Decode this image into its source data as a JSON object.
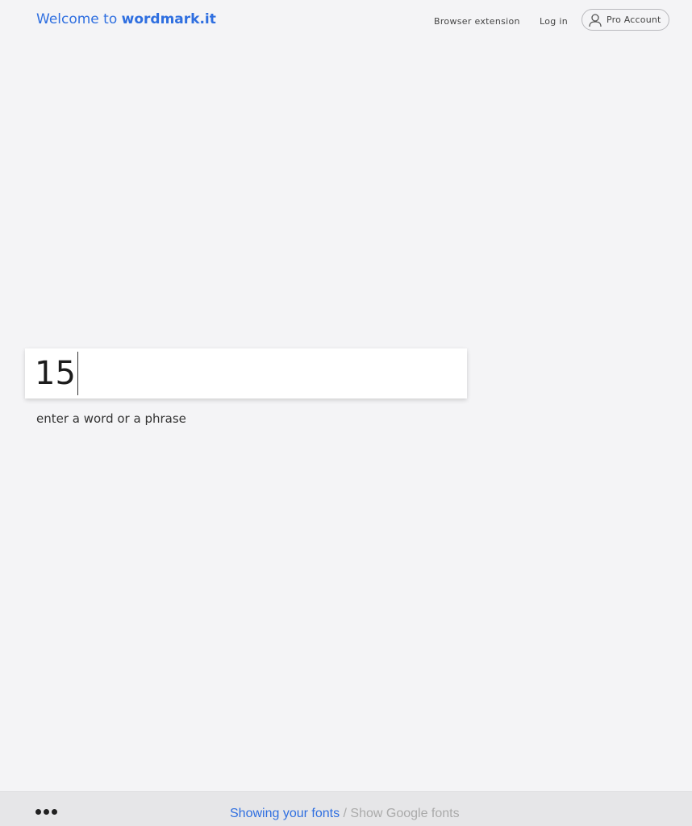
{
  "header": {
    "brand_prefix": "Welcome to ",
    "brand_name": "wordmark.it",
    "nav": {
      "browser_extension": "Browser extension",
      "log_in": "Log in",
      "pro_account": "Pro Account"
    },
    "pro_icon": "user-icon"
  },
  "main": {
    "input_value": "15",
    "hint": "enter a word or a phrase"
  },
  "footer": {
    "more_icon": "ellipsis-icon",
    "showing_your_fonts": "Showing your fonts",
    "separator": " / ",
    "show_google_fonts": "Show Google fonts"
  },
  "colors": {
    "accent": "#2f6fe0",
    "background": "#f4f4f6",
    "footer_bg": "#e6e6e8",
    "muted": "#aaaaaa"
  }
}
